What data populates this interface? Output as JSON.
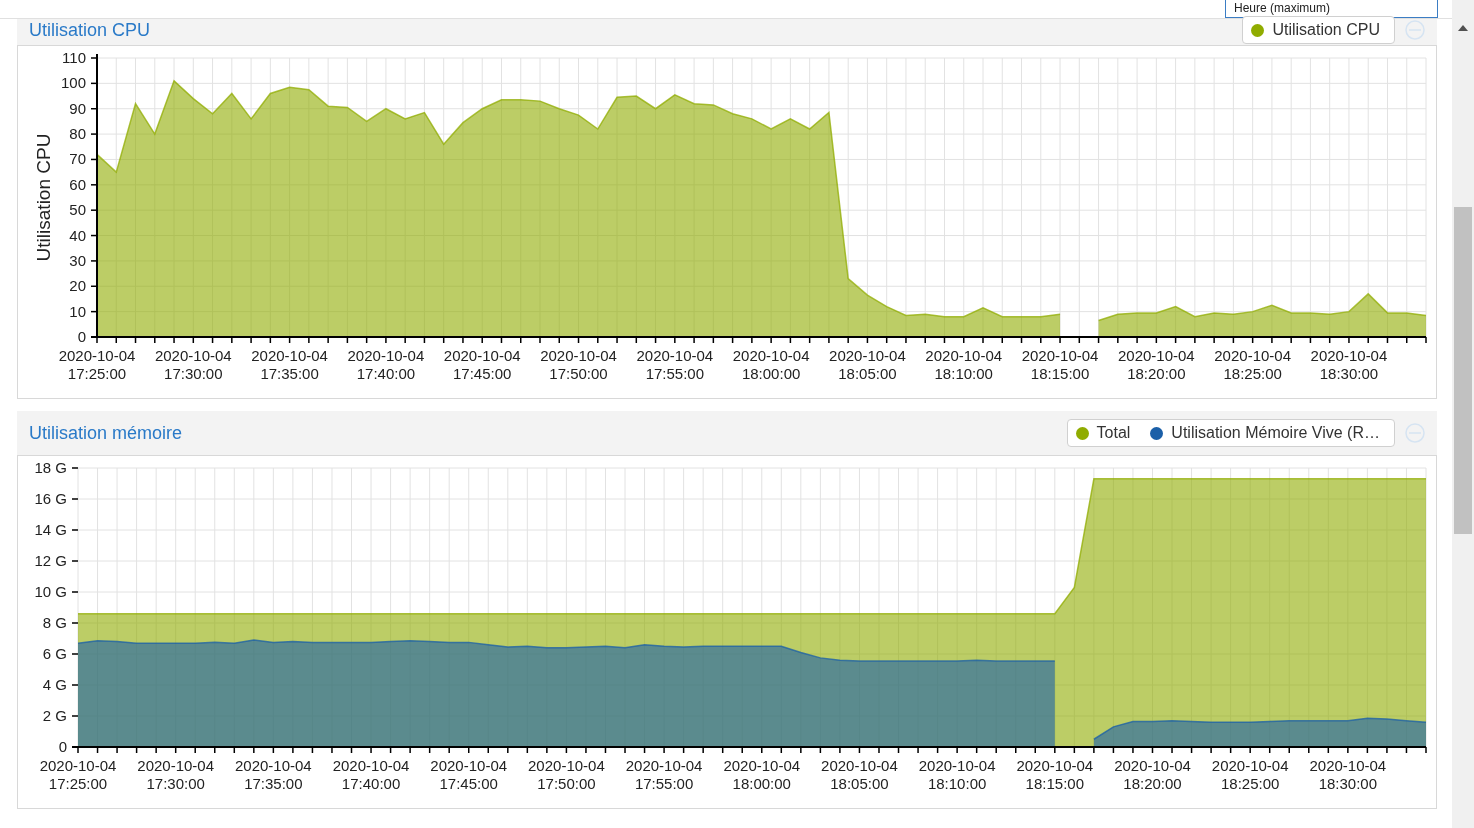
{
  "top_bar": {
    "dropdown": {
      "value": "Heure (maximum)"
    }
  },
  "panels": [
    {
      "title": "Utilisation CPU",
      "chart_data": {
        "type": "area",
        "ylabel": "Utilisation CPU",
        "grid": true,
        "ylim": [
          0,
          110
        ],
        "yticks": [
          0,
          10,
          20,
          30,
          40,
          50,
          60,
          70,
          80,
          90,
          100,
          110
        ],
        "categories": [
          "2020-10-04 17:25:00",
          null,
          null,
          null,
          null,
          "2020-10-04 17:30:00",
          null,
          null,
          null,
          null,
          "2020-10-04 17:35:00",
          null,
          null,
          null,
          null,
          "2020-10-04 17:40:00",
          null,
          null,
          null,
          null,
          "2020-10-04 17:45:00",
          null,
          null,
          null,
          null,
          "2020-10-04 17:50:00",
          null,
          null,
          null,
          null,
          "2020-10-04 17:55:00",
          null,
          null,
          null,
          null,
          "2020-10-04 18:00:00",
          null,
          null,
          null,
          null,
          "2020-10-04 18:05:00",
          null,
          null,
          null,
          null,
          "2020-10-04 18:10:00",
          null,
          null,
          null,
          null,
          "2020-10-04 18:15:00",
          null,
          null,
          null,
          null,
          "2020-10-04 18:20:00",
          null,
          null,
          null,
          null,
          "2020-10-04 18:25:00",
          null,
          null,
          null,
          null,
          "2020-10-04 18:30:00",
          null,
          null,
          null,
          null
        ],
        "series": [
          {
            "name": "Utilisation CPU",
            "color": "#90ac00",
            "values": [
              72,
              65,
              92,
              80,
              101,
              94,
              88,
              96,
              86,
              96,
              98.5,
              97.5,
              91,
              90.5,
              85,
              90,
              86,
              88.5,
              76,
              84.5,
              90,
              93.5,
              93.5,
              93,
              90,
              87.5,
              82,
              94.5,
              95,
              90,
              95.5,
              92,
              91.5,
              88,
              86,
              82,
              86,
              82,
              88.5,
              23,
              16.5,
              12,
              8.5,
              9,
              8,
              8,
              11.5,
              8,
              8,
              8,
              9,
              null,
              6.5,
              9,
              9.5,
              9.5,
              12,
              8,
              9.5,
              9,
              10,
              12.5,
              9.5,
              9.5,
              9,
              10,
              17,
              9.5,
              9.5,
              8.5
            ]
          }
        ]
      }
    },
    {
      "title": "Utilisation mémoire",
      "chart_data": {
        "type": "area",
        "grid": true,
        "ylim": [
          0,
          18
        ],
        "yticks": [
          {
            "value": 0,
            "label": "0"
          },
          {
            "value": 2,
            "label": "2 G"
          },
          {
            "value": 4,
            "label": "4 G"
          },
          {
            "value": 6,
            "label": "6 G"
          },
          {
            "value": 8,
            "label": "8 G"
          },
          {
            "value": 10,
            "label": "10 G"
          },
          {
            "value": 12,
            "label": "12 G"
          },
          {
            "value": 14,
            "label": "14 G"
          },
          {
            "value": 16,
            "label": "16 G"
          },
          {
            "value": 18,
            "label": "18 G"
          }
        ],
        "categories": [
          "2020-10-04 17:25:00",
          null,
          null,
          null,
          null,
          "2020-10-04 17:30:00",
          null,
          null,
          null,
          null,
          "2020-10-04 17:35:00",
          null,
          null,
          null,
          null,
          "2020-10-04 17:40:00",
          null,
          null,
          null,
          null,
          "2020-10-04 17:45:00",
          null,
          null,
          null,
          null,
          "2020-10-04 17:50:00",
          null,
          null,
          null,
          null,
          "2020-10-04 17:55:00",
          null,
          null,
          null,
          null,
          "2020-10-04 18:00:00",
          null,
          null,
          null,
          null,
          "2020-10-04 18:05:00",
          null,
          null,
          null,
          null,
          "2020-10-04 18:10:00",
          null,
          null,
          null,
          null,
          "2020-10-04 18:15:00",
          null,
          null,
          null,
          null,
          "2020-10-04 18:20:00",
          null,
          null,
          null,
          null,
          "2020-10-04 18:25:00",
          null,
          null,
          null,
          null,
          "2020-10-04 18:30:00",
          null,
          null,
          null,
          null
        ],
        "series": [
          {
            "name": "Total",
            "color": "#90ac00",
            "values": [
              8.6,
              8.6,
              8.6,
              8.6,
              8.6,
              8.6,
              8.6,
              8.6,
              8.6,
              8.6,
              8.6,
              8.6,
              8.6,
              8.6,
              8.6,
              8.6,
              8.6,
              8.6,
              8.6,
              8.6,
              8.6,
              8.6,
              8.6,
              8.6,
              8.6,
              8.6,
              8.6,
              8.6,
              8.6,
              8.6,
              8.6,
              8.6,
              8.6,
              8.6,
              8.6,
              8.6,
              8.6,
              8.6,
              8.6,
              8.6,
              8.6,
              8.6,
              8.6,
              8.6,
              8.6,
              8.6,
              8.6,
              8.6,
              8.6,
              8.6,
              8.6,
              10.3,
              17.3,
              17.3,
              17.3,
              17.3,
              17.3,
              17.3,
              17.3,
              17.3,
              17.3,
              17.3,
              17.3,
              17.3,
              17.3,
              17.3,
              17.3,
              17.3,
              17.3,
              17.3
            ]
          },
          {
            "name": "Utilisation Mémoire Vive (R…",
            "color": "#1a5fa8",
            "values": [
              6.7,
              6.85,
              6.8,
              6.7,
              6.7,
              6.7,
              6.7,
              6.75,
              6.7,
              6.9,
              6.75,
              6.8,
              6.75,
              6.75,
              6.75,
              6.75,
              6.8,
              6.85,
              6.8,
              6.75,
              6.75,
              6.6,
              6.45,
              6.5,
              6.4,
              6.4,
              6.45,
              6.5,
              6.4,
              6.6,
              6.5,
              6.45,
              6.5,
              6.5,
              6.5,
              6.5,
              6.5,
              6.1,
              5.75,
              5.6,
              5.55,
              5.55,
              5.55,
              5.55,
              5.55,
              5.55,
              5.6,
              5.55,
              5.55,
              5.55,
              5.55,
              null,
              0.5,
              1.3,
              1.65,
              1.65,
              1.7,
              1.65,
              1.6,
              1.6,
              1.6,
              1.65,
              1.7,
              1.7,
              1.7,
              1.7,
              1.85,
              1.8,
              1.7,
              1.6
            ]
          }
        ]
      }
    }
  ]
}
